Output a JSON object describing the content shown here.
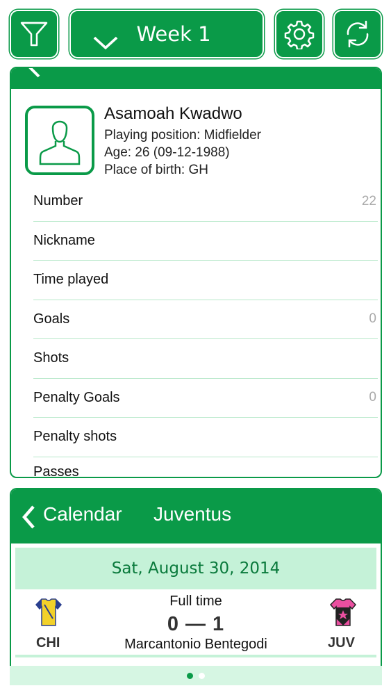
{
  "toolbar": {
    "week_label": "Week 1"
  },
  "player": {
    "name": "Asamoah Kwadwo",
    "position_line": "Playing position: Midfielder",
    "age_line": "Age: 26 (09-12-1988)",
    "birth_line": "Place of birth: GH"
  },
  "stats": [
    {
      "label": "Number",
      "value": "22"
    },
    {
      "label": "Nickname",
      "value": ""
    },
    {
      "label": "Time played",
      "value": ""
    },
    {
      "label": "Goals",
      "value": "0"
    },
    {
      "label": "Shots",
      "value": ""
    },
    {
      "label": "Penalty Goals",
      "value": "0"
    },
    {
      "label": "Penalty shots",
      "value": ""
    },
    {
      "label": "Passes",
      "value": ""
    }
  ],
  "calendar": {
    "title": "Calendar",
    "team": "Juventus",
    "date": "Sat, August 30, 2014",
    "match": {
      "status": "Full time",
      "score": "0 — 1",
      "venue": "Marcantonio Bentegodi",
      "home_code": "CHI",
      "away_code": "JUV",
      "home_kit_color": "#f2d12a",
      "away_kit_color": "#ea4fa0"
    }
  },
  "pager": {
    "pages": 2,
    "current": 1
  },
  "colors": {
    "accent": "#0a9a48",
    "light_accent": "#c5f2d8"
  }
}
